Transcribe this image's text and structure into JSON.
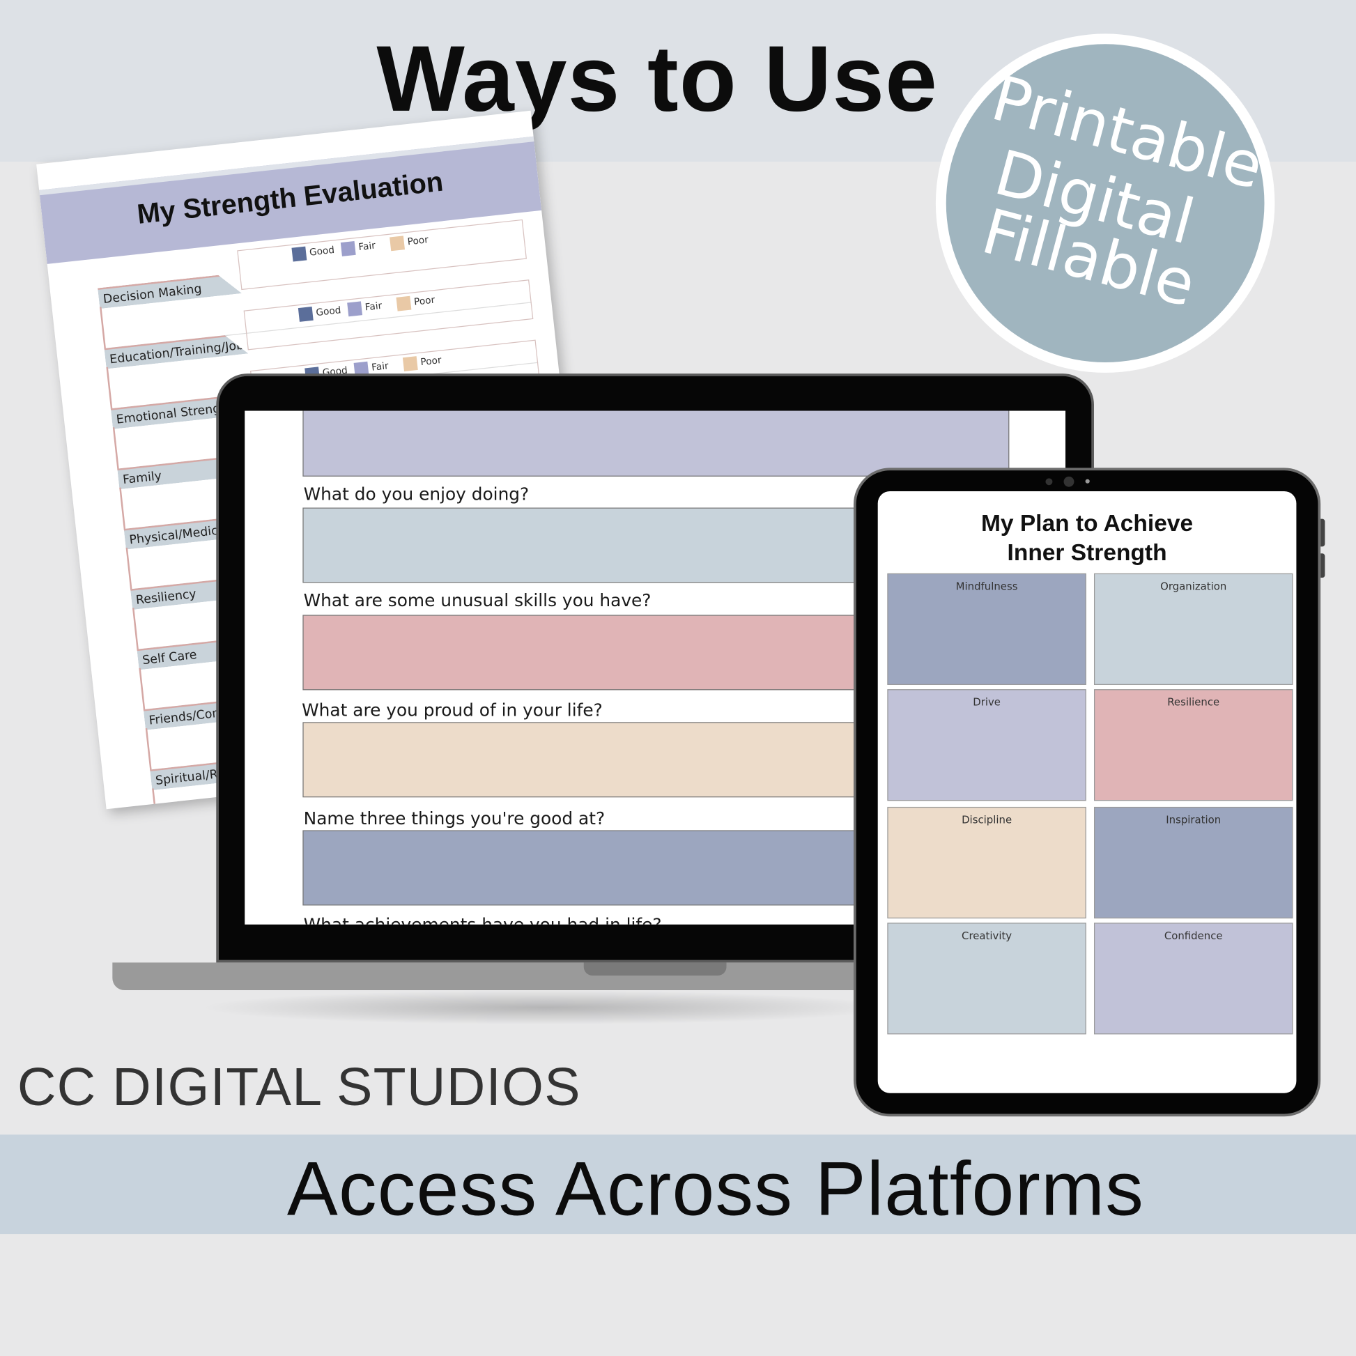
{
  "header": {
    "title": "Ways to Use"
  },
  "badge": {
    "lines": [
      "Printable",
      "Digital",
      "Fillable"
    ],
    "color": "#a0b5bf"
  },
  "paper": {
    "title": "My Strength Evaluation",
    "legend": [
      "Good",
      "Fair",
      "Poor"
    ],
    "legend_colors": [
      "#5b6e9a",
      "#9c9fcb",
      "#e9c9a6"
    ],
    "rows": [
      "Decision Making",
      "Education/Training/Job",
      "Emotional Strengths",
      "Family",
      "Physical/Medical H",
      "Resiliency",
      "Self Care",
      "Friends/Conn",
      "Spiritual/Rel"
    ]
  },
  "laptop": {
    "questions": [
      {
        "label": "",
        "color": "#c1c2d8"
      },
      {
        "label": "What do you enjoy doing?",
        "color": "#c8d3db"
      },
      {
        "label": "What are some unusual skills you have?",
        "color": "#e0b4b6"
      },
      {
        "label": "What are you proud of in your life?",
        "color": "#eddcca"
      },
      {
        "label": "Name three things you're good at?",
        "color": "#9ca6bf"
      },
      {
        "label": "What achievements have you had in life?",
        "color": ""
      }
    ]
  },
  "tablet": {
    "title_line1": "My Plan to Achieve",
    "title_line2": "Inner Strength",
    "cells": [
      {
        "label": "Mindfulness",
        "color": "#9ca6bf"
      },
      {
        "label": "Organization",
        "color": "#c8d3db"
      },
      {
        "label": "Drive",
        "color": "#c1c2d8"
      },
      {
        "label": "Resilience",
        "color": "#e0b4b6"
      },
      {
        "label": "Discipline",
        "color": "#eddcca"
      },
      {
        "label": "Inspiration",
        "color": "#9ca6bf"
      },
      {
        "label": "Creativity",
        "color": "#c8d3db"
      },
      {
        "label": "Confidence",
        "color": "#c1c2d8"
      }
    ]
  },
  "footer": {
    "brand": "CC DIGITAL STUDIOS",
    "tagline": "Access Across Platforms"
  }
}
